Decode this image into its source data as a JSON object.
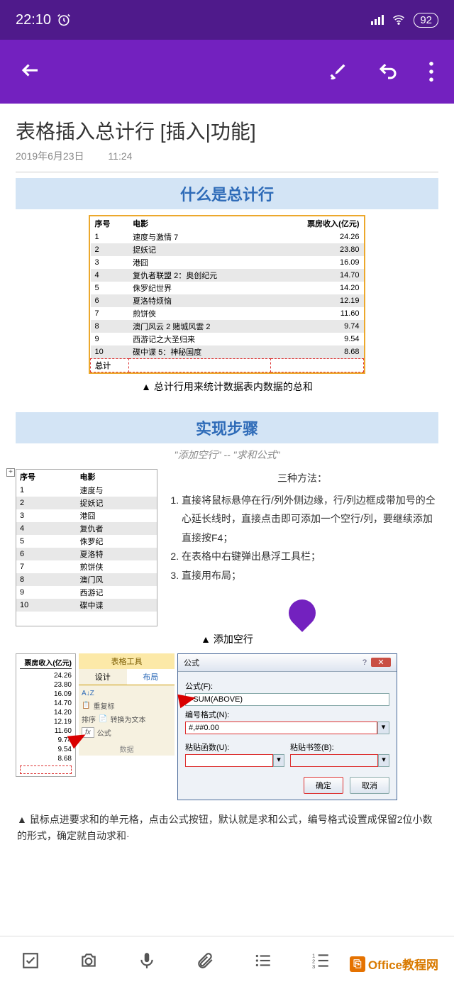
{
  "status": {
    "time": "22:10",
    "battery": "92"
  },
  "note": {
    "title": "表格插入总计行 [插入|功能]",
    "date": "2019年6月23日",
    "time": "11:24"
  },
  "section1": {
    "heading": "什么是总计行",
    "columns": [
      "序号",
      "电影",
      "票房收入(亿元)"
    ],
    "rows": [
      [
        "1",
        "速度与激情 7",
        "24.26"
      ],
      [
        "2",
        "捉妖记",
        "23.80"
      ],
      [
        "3",
        "港囧",
        "16.09"
      ],
      [
        "4",
        "复仇者联盟 2：奥创纪元",
        "14.70"
      ],
      [
        "5",
        "侏罗纪世界",
        "14.20"
      ],
      [
        "6",
        "夏洛特烦恼",
        "12.19"
      ],
      [
        "7",
        "煎饼侠",
        "11.60"
      ],
      [
        "8",
        "澳门风云 2 赌城风雲 2",
        "9.74"
      ],
      [
        "9",
        "西游记之大圣归来",
        "9.54"
      ],
      [
        "10",
        "碟中谍 5：神秘国度",
        "8.68"
      ]
    ],
    "total_label": "总计",
    "caption": "▲ 总计行用来统计数据表内数据的总和"
  },
  "section2": {
    "heading": "实现步骤",
    "quote": "\"添加空行\"  --  \"求和公式\"",
    "mini_cols": [
      "序号",
      "电影"
    ],
    "mini_rows": [
      [
        "1",
        "速度与"
      ],
      [
        "2",
        "捉妖记"
      ],
      [
        "3",
        "港囧"
      ],
      [
        "4",
        "复仇者"
      ],
      [
        "5",
        "侏罗纪"
      ],
      [
        "6",
        "夏洛特"
      ],
      [
        "7",
        "煎饼侠"
      ],
      [
        "8",
        "澳门风"
      ],
      [
        "9",
        "西游记"
      ],
      [
        "10",
        "碟中谍"
      ]
    ],
    "methods_title": "三种方法：",
    "methods": [
      "直接将鼠标悬停在行/列外侧边缘，行/列边框成带加号的仝心延长线时，直接点击即可添加一个空行/列，要继续添加直接按F4；",
      "在表格中右键弹出悬浮工具栏；",
      "直接用布局；"
    ],
    "caption": "▲ 添加空行"
  },
  "section3": {
    "col_head": "票房收入(亿元)",
    "col_vals": [
      "24.26",
      "23.80",
      "16.09",
      "14.70",
      "14.20",
      "12.19",
      "11.60",
      "9.74",
      "9.54",
      "8.68"
    ],
    "ribbon": {
      "title": "表格工具",
      "tabs": [
        "设计",
        "布局"
      ],
      "sort": "排序",
      "repeat": "重复标",
      "convert": "转换为文本",
      "formula": "公式",
      "group": "数据"
    },
    "dialog": {
      "title": "公式",
      "lbl_formula": "公式(F):",
      "val_formula": "=SUM(ABOVE)",
      "lbl_format": "编号格式(N):",
      "val_format": "#,##0.00",
      "lbl_paste_fn": "粘贴函数(U):",
      "lbl_paste_bm": "粘贴书签(B):",
      "ok": "确定",
      "cancel": "取消"
    },
    "desc": "▲ 鼠标点进要求和的单元格，点击公式按钮，默认就是求和公式，编号格式设置成保留2位小数的形式，确定就自动求和·"
  },
  "watermark": "Office教程网",
  "fx_label": "fx"
}
